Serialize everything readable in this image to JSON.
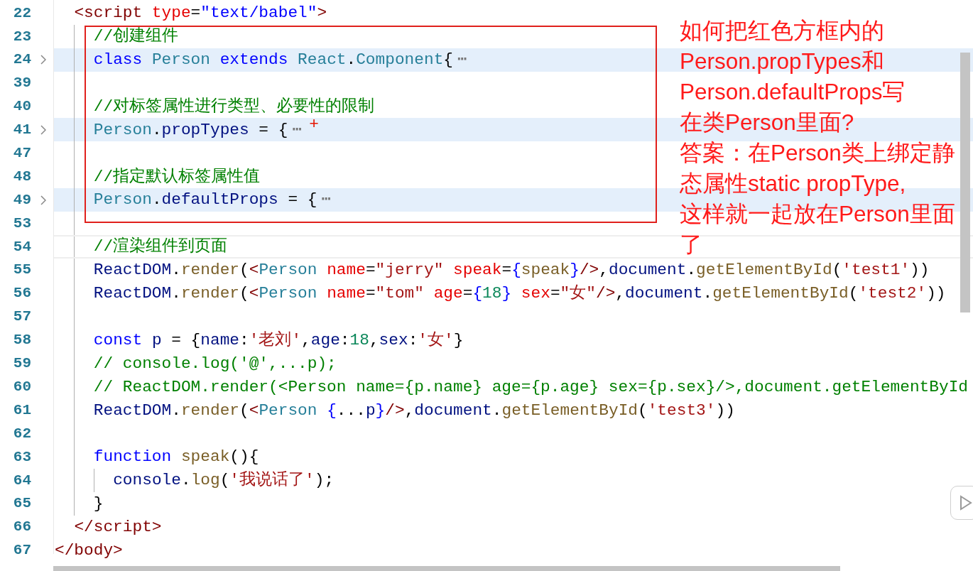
{
  "editor": {
    "lines": [
      {
        "number": "22",
        "tokens": [
          {
            "text": "<script ",
            "kind": "tag"
          },
          {
            "text": "type",
            "kind": "attr"
          },
          {
            "text": "=",
            "kind": "punc"
          },
          {
            "text": "\"text/babel\"",
            "kind": "attrval"
          },
          {
            "text": ">",
            "kind": "tag"
          }
        ],
        "children": [
          {
            "number": "23",
            "tokens": [
              {
                "text": "//创建组件",
                "kind": "comment"
              }
            ]
          },
          {
            "number": "24",
            "folded": true,
            "highlighted": true,
            "tokens": [
              {
                "text": "class ",
                "kind": "kw"
              },
              {
                "text": "Person ",
                "kind": "type"
              },
              {
                "text": "extends ",
                "kind": "kw"
              },
              {
                "text": "React",
                "kind": "type"
              },
              {
                "text": ".",
                "kind": "punc"
              },
              {
                "text": "Component",
                "kind": "type"
              },
              {
                "text": "{",
                "kind": "punc"
              },
              {
                "text": "⋯",
                "kind": "fold"
              }
            ]
          },
          {
            "number": "39"
          },
          {
            "number": "40",
            "tokens": [
              {
                "text": "//对标签属性进行类型、必要性的限制",
                "kind": "comment"
              }
            ]
          },
          {
            "number": "41",
            "folded": true,
            "highlighted": true,
            "tokens": [
              {
                "text": "Person",
                "kind": "type"
              },
              {
                "text": ".",
                "kind": "punc"
              },
              {
                "text": "propTypes",
                "kind": "var"
              },
              {
                "text": " = {",
                "kind": "punc"
              },
              {
                "text": "⋯",
                "kind": "fold"
              },
              {
                "text": "+",
                "kind": "mark"
              }
            ]
          },
          {
            "number": "47"
          },
          {
            "number": "48",
            "tokens": [
              {
                "text": "//指定默认标签属性值",
                "kind": "comment"
              }
            ]
          },
          {
            "number": "49",
            "folded": true,
            "highlighted": true,
            "tokens": [
              {
                "text": "Person",
                "kind": "type"
              },
              {
                "text": ".",
                "kind": "punc"
              },
              {
                "text": "defaultProps",
                "kind": "var"
              },
              {
                "text": " = {",
                "kind": "punc"
              },
              {
                "text": "⋯",
                "kind": "fold"
              }
            ]
          },
          {
            "number": "53"
          },
          {
            "number": "54",
            "current": true,
            "tokens": [
              {
                "text": "//渲染组件到页面",
                "kind": "comment"
              }
            ]
          },
          {
            "number": "55",
            "tokens": [
              {
                "text": "ReactDOM",
                "kind": "var"
              },
              {
                "text": ".",
                "kind": "punc"
              },
              {
                "text": "render",
                "kind": "fn"
              },
              {
                "text": "(",
                "kind": "punc"
              },
              {
                "text": "<",
                "kind": "tag"
              },
              {
                "text": "Person ",
                "kind": "type"
              },
              {
                "text": "name",
                "kind": "attr"
              },
              {
                "text": "=",
                "kind": "punc"
              },
              {
                "text": "\"jerry\" ",
                "kind": "str"
              },
              {
                "text": "speak",
                "kind": "attr"
              },
              {
                "text": "=",
                "kind": "punc"
              },
              {
                "text": "{",
                "kind": "kw"
              },
              {
                "text": "speak",
                "kind": "fn"
              },
              {
                "text": "}",
                "kind": "kw"
              },
              {
                "text": "/>",
                "kind": "tag"
              },
              {
                "text": ",",
                "kind": "punc"
              },
              {
                "text": "document",
                "kind": "var"
              },
              {
                "text": ".",
                "kind": "punc"
              },
              {
                "text": "getElementById",
                "kind": "fn"
              },
              {
                "text": "(",
                "kind": "punc"
              },
              {
                "text": "'test1'",
                "kind": "str"
              },
              {
                "text": "))",
                "kind": "punc"
              }
            ]
          },
          {
            "number": "56",
            "tokens": [
              {
                "text": "ReactDOM",
                "kind": "var"
              },
              {
                "text": ".",
                "kind": "punc"
              },
              {
                "text": "render",
                "kind": "fn"
              },
              {
                "text": "(",
                "kind": "punc"
              },
              {
                "text": "<",
                "kind": "tag"
              },
              {
                "text": "Person ",
                "kind": "type"
              },
              {
                "text": "name",
                "kind": "attr"
              },
              {
                "text": "=",
                "kind": "punc"
              },
              {
                "text": "\"tom\" ",
                "kind": "str"
              },
              {
                "text": "age",
                "kind": "attr"
              },
              {
                "text": "=",
                "kind": "punc"
              },
              {
                "text": "{",
                "kind": "kw"
              },
              {
                "text": "18",
                "kind": "num"
              },
              {
                "text": "} ",
                "kind": "kw"
              },
              {
                "text": "sex",
                "kind": "attr"
              },
              {
                "text": "=",
                "kind": "punc"
              },
              {
                "text": "\"女\"",
                "kind": "str"
              },
              {
                "text": "/>",
                "kind": "tag"
              },
              {
                "text": ",",
                "kind": "punc"
              },
              {
                "text": "document",
                "kind": "var"
              },
              {
                "text": ".",
                "kind": "punc"
              },
              {
                "text": "getElementById",
                "kind": "fn"
              },
              {
                "text": "(",
                "kind": "punc"
              },
              {
                "text": "'test2'",
                "kind": "str"
              },
              {
                "text": "))",
                "kind": "punc"
              }
            ]
          },
          {
            "number": "57"
          },
          {
            "number": "58",
            "tokens": [
              {
                "text": "const ",
                "kind": "kw"
              },
              {
                "text": "p",
                "kind": "var"
              },
              {
                "text": " = {",
                "kind": "punc"
              },
              {
                "text": "name",
                "kind": "var"
              },
              {
                "text": ":",
                "kind": "punc"
              },
              {
                "text": "'老刘'",
                "kind": "str"
              },
              {
                "text": ",",
                "kind": "punc"
              },
              {
                "text": "age",
                "kind": "var"
              },
              {
                "text": ":",
                "kind": "punc"
              },
              {
                "text": "18",
                "kind": "num"
              },
              {
                "text": ",",
                "kind": "punc"
              },
              {
                "text": "sex",
                "kind": "var"
              },
              {
                "text": ":",
                "kind": "punc"
              },
              {
                "text": "'女'",
                "kind": "str"
              },
              {
                "text": "}",
                "kind": "punc"
              }
            ]
          },
          {
            "number": "59",
            "tokens": [
              {
                "text": "// console.log('@',...p);",
                "kind": "comment"
              }
            ]
          },
          {
            "number": "60",
            "tokens": [
              {
                "text": "// ReactDOM.render(<Person name={p.name} age={p.age} sex={p.sex}/>,document.getElementById",
                "kind": "comment"
              }
            ]
          },
          {
            "number": "61",
            "tokens": [
              {
                "text": "ReactDOM",
                "kind": "var"
              },
              {
                "text": ".",
                "kind": "punc"
              },
              {
                "text": "render",
                "kind": "fn"
              },
              {
                "text": "(",
                "kind": "punc"
              },
              {
                "text": "<",
                "kind": "tag"
              },
              {
                "text": "Person ",
                "kind": "type"
              },
              {
                "text": "{",
                "kind": "kw"
              },
              {
                "text": "...",
                "kind": "punc"
              },
              {
                "text": "p",
                "kind": "var"
              },
              {
                "text": "}",
                "kind": "kw"
              },
              {
                "text": "/>",
                "kind": "tag"
              },
              {
                "text": ",",
                "kind": "punc"
              },
              {
                "text": "document",
                "kind": "var"
              },
              {
                "text": ".",
                "kind": "punc"
              },
              {
                "text": "getElementById",
                "kind": "fn"
              },
              {
                "text": "(",
                "kind": "punc"
              },
              {
                "text": "'test3'",
                "kind": "str"
              },
              {
                "text": "))",
                "kind": "punc"
              }
            ]
          },
          {
            "number": "62"
          },
          {
            "number": "63",
            "tokens": [
              {
                "text": "function ",
                "kind": "kw"
              },
              {
                "text": "speak",
                "kind": "fn"
              },
              {
                "text": "(){",
                "kind": "punc"
              }
            ],
            "children": [
              {
                "number": "64",
                "tokens": [
                  {
                    "text": "console",
                    "kind": "var"
                  },
                  {
                    "text": ".",
                    "kind": "punc"
                  },
                  {
                    "text": "log",
                    "kind": "fn"
                  },
                  {
                    "text": "(",
                    "kind": "punc"
                  },
                  {
                    "text": "'我说话了'",
                    "kind": "str"
                  },
                  {
                    "text": ");",
                    "kind": "punc"
                  }
                ]
              }
            ]
          },
          {
            "number": "65",
            "tokens": [
              {
                "text": "}",
                "kind": "punc"
              }
            ]
          }
        ]
      },
      {
        "number": "66",
        "tokens": [
          {
            "text": "</script>",
            "kind": "tag"
          }
        ]
      },
      {
        "number": "67",
        "outdented": true,
        "tokens": [
          {
            "text": "</body>",
            "kind": "tag"
          }
        ]
      }
    ]
  },
  "annotation": {
    "lines": [
      "如何把红色方框内的",
      "Person.propTypes和",
      "Person.defaultProps写",
      "在类Person里面?",
      "答案：在Person类上绑定静",
      "态属性static propType,",
      "这样就一起放在Person里面",
      "了"
    ]
  }
}
